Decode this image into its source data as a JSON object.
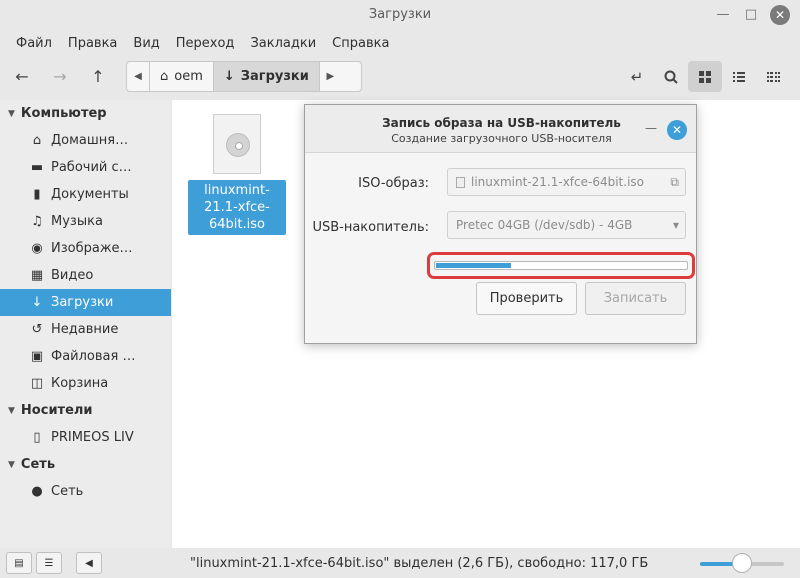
{
  "window": {
    "title": "Загрузки"
  },
  "menu": [
    "Файл",
    "Правка",
    "Вид",
    "Переход",
    "Закладки",
    "Справка"
  ],
  "pathbar": {
    "crumbs": [
      "oem",
      "Загрузки"
    ]
  },
  "sidebar": {
    "sections": [
      {
        "label": "Компьютер",
        "items": [
          {
            "label": "Домашня…",
            "icon": "home-icon"
          },
          {
            "label": "Рабочий с…",
            "icon": "desktop-icon"
          },
          {
            "label": "Документы",
            "icon": "document-icon"
          },
          {
            "label": "Музыка",
            "icon": "music-icon"
          },
          {
            "label": "Изображе…",
            "icon": "camera-icon"
          },
          {
            "label": "Видео",
            "icon": "film-icon"
          },
          {
            "label": "Загрузки",
            "icon": "download-icon",
            "selected": true
          },
          {
            "label": "Недавние",
            "icon": "history-icon"
          },
          {
            "label": "Файловая …",
            "icon": "drive-icon"
          },
          {
            "label": "Корзина",
            "icon": "trash-icon"
          }
        ]
      },
      {
        "label": "Носители",
        "items": [
          {
            "label": "PRIMEOS LIV",
            "icon": "usb-drive-icon"
          }
        ]
      },
      {
        "label": "Сеть",
        "items": [
          {
            "label": "Сеть",
            "icon": "network-icon"
          }
        ]
      }
    ]
  },
  "file": {
    "name": "linuxmint-21.1-xfce-64bit.iso",
    "icon": "disc-image-icon"
  },
  "status": {
    "text": "\"linuxmint-21.1-xfce-64bit.iso\" выделен (2,6 ГБ), свободно: 117,0 ГБ",
    "zoom_level": 0.5
  },
  "dialog": {
    "title": "Запись образа на USB-накопитель",
    "subtitle": "Создание загрузочного USB-носителя",
    "iso_label": "ISO-образ:",
    "iso_value": "linuxmint-21.1-xfce-64bit.iso",
    "usb_label": "USB-накопитель:",
    "usb_value": "Pretec 04GB (/dev/sdb) - 4GB",
    "progress": 0.3,
    "verify_label": "Проверить",
    "write_label": "Записать"
  },
  "colors": {
    "accent": "#3d9ed8",
    "highlight": "#dd3c3c"
  }
}
